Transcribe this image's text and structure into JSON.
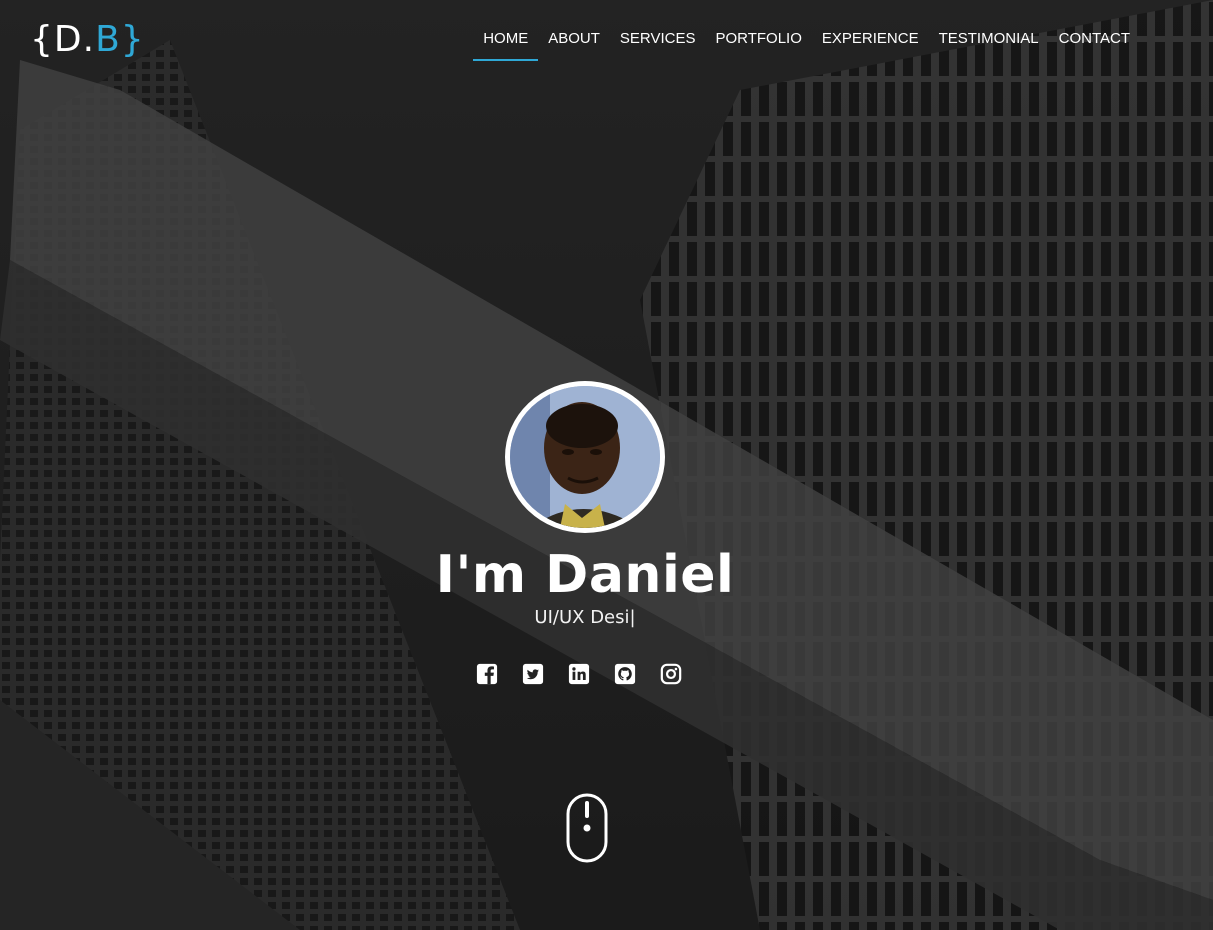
{
  "brand": {
    "logo_open": "{D.",
    "logo_accent": "B}",
    "accent_color": "#2fa8d6"
  },
  "nav": {
    "items": [
      {
        "label": "HOME",
        "active": true
      },
      {
        "label": "ABOUT"
      },
      {
        "label": "SERVICES"
      },
      {
        "label": "PORTFOLIO"
      },
      {
        "label": "EXPERIENCE"
      },
      {
        "label": "TESTIMONIAL"
      },
      {
        "label": "CONTACT"
      }
    ]
  },
  "hero": {
    "name": "I'm Daniel",
    "role": "UI/UX Desi|"
  },
  "socials": [
    {
      "icon": "facebook-icon"
    },
    {
      "icon": "twitter-icon"
    },
    {
      "icon": "linkedin-icon"
    },
    {
      "icon": "github-icon"
    },
    {
      "icon": "instagram-icon"
    }
  ],
  "scroll": {
    "icon": "mouse-scroll-icon"
  }
}
